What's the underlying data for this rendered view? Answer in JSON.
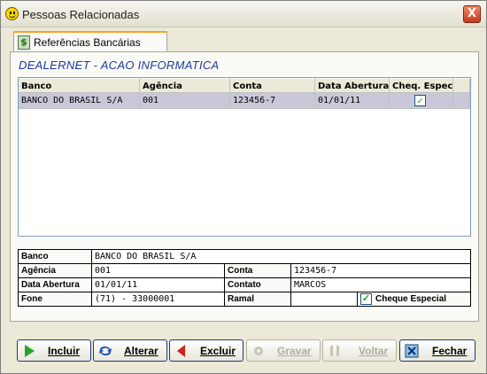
{
  "window": {
    "title": "Pessoas Relacionadas",
    "close_glyph": "X"
  },
  "tab": {
    "label": "Referências Bancárias",
    "icon": "dollar-icon",
    "icon_glyph": "$"
  },
  "company": "DEALERNET - ACAO INFORMATICA",
  "grid": {
    "columns": [
      "Banco",
      "Agência",
      "Conta",
      "Data Abertura",
      "Cheq. Espec."
    ],
    "rows": [
      {
        "banco": "BANCO DO BRASIL S/A",
        "agencia": "001",
        "conta": "123456-7",
        "data_abertura": "01/01/11",
        "cheq_espec": true
      }
    ]
  },
  "form": {
    "banco_label": "Banco",
    "banco_value": "BANCO DO BRASIL S/A",
    "agencia_label": "Agência",
    "agencia_value": "001",
    "conta_label": "Conta",
    "conta_value": "123456-7",
    "data_abertura_label": "Data Abertura",
    "data_abertura_value": "01/01/11",
    "contato_label": "Contato",
    "contato_value": "MARCOS",
    "fone_label": "Fone",
    "fone_value": "(71) - 33000001",
    "ramal_label": "Ramal",
    "ramal_value": "",
    "cheque_especial_label": "Cheque Especial",
    "cheque_especial_checked": true
  },
  "toolbar": {
    "incluir": "Incluir",
    "alterar": "Alterar",
    "excluir": "Excluir",
    "gravar": "Gravar",
    "voltar": "Voltar",
    "fechar": "Fechar"
  },
  "check_glyph": "✓",
  "colors": {
    "title_accent": "#f1a72a",
    "company_text": "#1d3a9a",
    "selected_row": "#c9c8d8",
    "button_border": "#1c3a78"
  }
}
